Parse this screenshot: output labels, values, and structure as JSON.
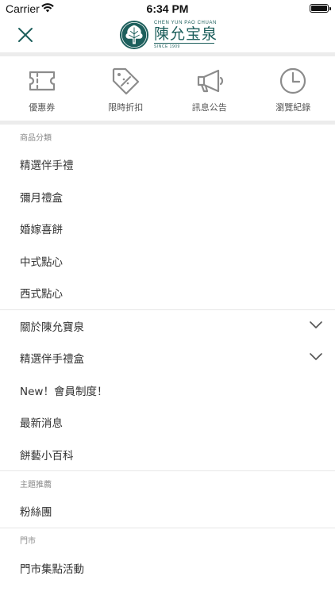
{
  "status": {
    "carrier": "Carrier",
    "time": "6:34 PM"
  },
  "header": {
    "logo_en": "CHEN YUN PAO CHUAN",
    "logo_zh": "陳允宝泉",
    "logo_since": "SINCE 1909"
  },
  "quick_actions": [
    {
      "label": "優惠券",
      "icon": "ticket-icon"
    },
    {
      "label": "限時折扣",
      "icon": "discount-tag-icon"
    },
    {
      "label": "訊息公告",
      "icon": "megaphone-icon"
    },
    {
      "label": "瀏覽紀錄",
      "icon": "clock-icon"
    }
  ],
  "categories": {
    "header": "商品分類",
    "items": [
      "精選伴手禮",
      "彌月禮盒",
      "婚嫁喜餅",
      "中式點心",
      "西式點心"
    ]
  },
  "info": {
    "items": [
      {
        "label": "關於陳允寶泉",
        "expandable": true
      },
      {
        "label": "精選伴手禮盒",
        "expandable": true
      },
      {
        "label": "New！會員制度！",
        "expandable": false
      },
      {
        "label": "最新消息",
        "expandable": false
      },
      {
        "label": "餅藝小百科",
        "expandable": false
      }
    ]
  },
  "featured": {
    "header": "主題推薦",
    "items": [
      "粉絲團"
    ]
  },
  "stores": {
    "header": "門市",
    "items": [
      "門市集點活動"
    ]
  },
  "colors": {
    "brand": "#1d5f5c",
    "icon_gray": "#8c8c8c",
    "divider": "#ececec"
  }
}
